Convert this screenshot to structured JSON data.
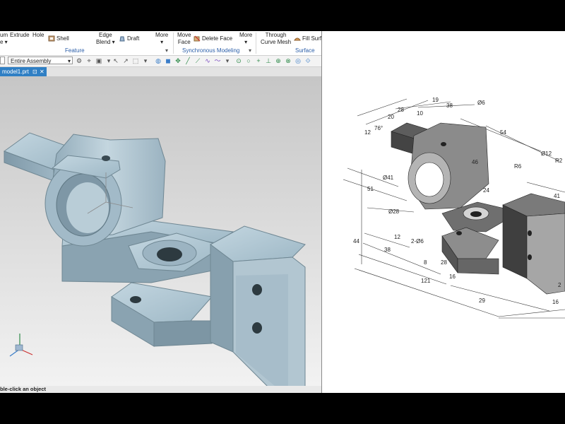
{
  "ribbon": {
    "items": [
      {
        "name": "extrude",
        "label": "Extrude"
      },
      {
        "name": "hole",
        "label": "Hole"
      },
      {
        "name": "shell",
        "label": "Shell"
      },
      {
        "name": "edge-blend",
        "label": "Edge\nBlend ▾"
      },
      {
        "name": "draft",
        "label": "Draft"
      },
      {
        "name": "more-feature",
        "label": "More\n▾"
      },
      {
        "name": "move-face",
        "label": "Move\nFace"
      },
      {
        "name": "delete-face",
        "label": "Delete Face"
      },
      {
        "name": "more-sync",
        "label": "More\n▾"
      },
      {
        "name": "through-curve-mesh",
        "label": "Through\nCurve Mesh"
      },
      {
        "name": "fill-surface",
        "label": "Fill Surfa"
      }
    ],
    "partial_left": {
      "top": "um",
      "bottom": "e ▾"
    },
    "groups": {
      "feature": "Feature",
      "synchronous": "Synchronous Modeling",
      "surface": "Surface"
    }
  },
  "toolbar": {
    "filter_value": "Entire Assembly"
  },
  "tab": {
    "label": "model1.prt",
    "pin": "⊡",
    "close": "✕"
  },
  "status": {
    "prompt": "ble-click an object"
  },
  "drawing": {
    "dimensions": [
      "28",
      "20",
      "10",
      "19",
      "38",
      "Ø6",
      "76°",
      "12",
      "54",
      "Ø12",
      "R2",
      "R6",
      "46",
      "Ø41",
      "24",
      "51",
      "Ø28",
      "41",
      "44",
      "12",
      "38",
      "2-Ø6",
      "8",
      "28",
      "121",
      "16",
      "29",
      "16",
      "2"
    ]
  },
  "colors": {
    "accent": "#2f7fc4",
    "group_text": "#2b5ea8",
    "model": "#a9c2cf"
  }
}
